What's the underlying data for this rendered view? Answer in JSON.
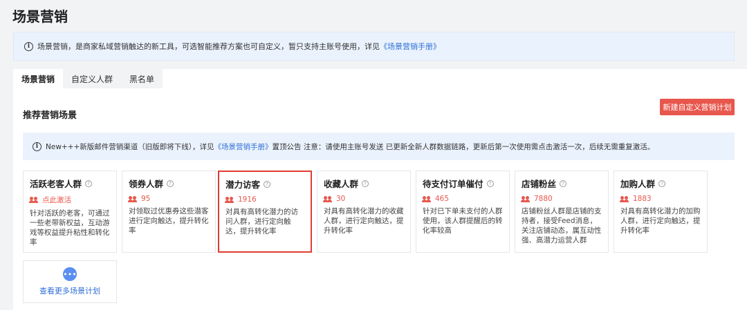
{
  "page": {
    "title": "场景营销"
  },
  "notice_top": {
    "icon": "info-icon",
    "text": "场景营销，是商家私域营销触达的新工具，可选智能推荐方案也可自定义，暂只支持主账号使用，详见",
    "link": "《场景营销手册》"
  },
  "tabs": [
    {
      "label": "场景营销",
      "active": true
    },
    {
      "label": "自定义人群",
      "active": false
    },
    {
      "label": "黑名单",
      "active": false
    }
  ],
  "section": {
    "title": "推荐营销场景",
    "new_button": "新建自定义营销计划"
  },
  "notice_inner": {
    "icon": "info-icon",
    "text_before": "New+++新版邮件营销渠道（旧版即将下线），详见",
    "link": "《场景营销手册》",
    "text_after": "置顶公告 注意：请使用主账号发送 已更新全新人群数据链路，更新后第一次使用需点击激活一次，后续无需重复激活。"
  },
  "cards": [
    {
      "title": "活跃老客人群",
      "stat": "点此激活",
      "desc": "针对活跃的老客，可通过一些老带新权益，互动游戏等权益提升粘性和转化率",
      "highlight": false
    },
    {
      "title": "领券人群",
      "stat": "95",
      "desc": "对领取过优惠券这些潜客进行定向触达，提升转化率",
      "highlight": false
    },
    {
      "title": "潜力访客",
      "stat": "1916",
      "desc": "对具有高转化潜力的访问人群，进行定向触达，提升转化率",
      "highlight": true
    },
    {
      "title": "收藏人群",
      "stat": "30",
      "desc": "对具有高转化潜力的收藏人群，进行定向触达，提升转化率",
      "highlight": false
    },
    {
      "title": "待支付订单催付",
      "stat": "465",
      "desc": "针对已下单未支付的人群使用，该人群提醒后的转化率较高",
      "highlight": false
    },
    {
      "title": "店铺粉丝",
      "stat": "7880",
      "desc": "店铺粉丝人群是店铺的支持者，接受Feed消息，关注店铺动态，属互动性强、高潜力运营人群",
      "highlight": false
    },
    {
      "title": "加购人群",
      "stat": "1883",
      "desc": "对具有高转化潜力的加购人群，进行定向触达，提升转化率",
      "highlight": false
    }
  ],
  "more": {
    "icon": "more-dots-icon",
    "dots": "•••",
    "label": "查看更多场景计划"
  },
  "colors": {
    "accent_red": "#e8574d",
    "link_blue": "#2f6fd6",
    "notice_bg": "#eaf2fd"
  }
}
